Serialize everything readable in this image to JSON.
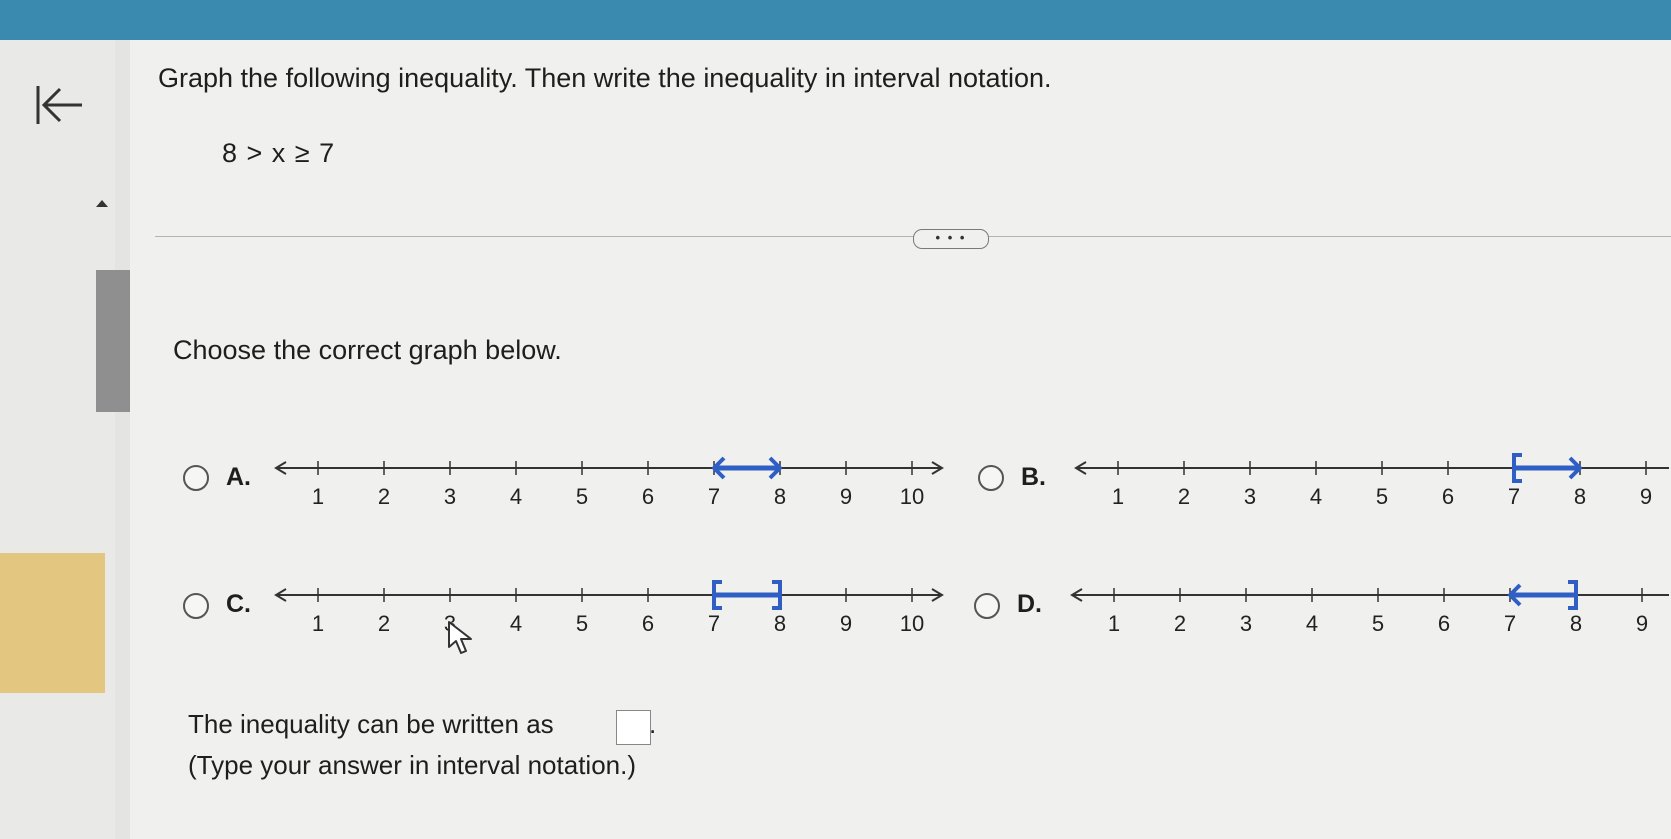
{
  "question": {
    "title": "Graph the following inequality. Then write the inequality in interval notation.",
    "inequality": "8 > x ≥ 7"
  },
  "more_button": "• • •",
  "prompt": "Choose the correct graph below.",
  "options": [
    {
      "letter": "A.",
      "ticks": [
        "1",
        "2",
        "3",
        "4",
        "5",
        "6",
        "7",
        "8",
        "9",
        "10"
      ],
      "interval": {
        "start": 7,
        "end": 8,
        "start_style": "arrow",
        "end_style": "arrow"
      }
    },
    {
      "letter": "B.",
      "ticks": [
        "1",
        "2",
        "3",
        "4",
        "5",
        "6",
        "7",
        "8",
        "9"
      ],
      "interval": {
        "start": 7,
        "end": 8,
        "start_style": "bracket",
        "end_style": "arrow"
      }
    },
    {
      "letter": "C.",
      "ticks": [
        "1",
        "2",
        "3",
        "4",
        "5",
        "6",
        "7",
        "8",
        "9",
        "10"
      ],
      "interval": {
        "start": 7,
        "end": 8,
        "start_style": "bracket",
        "end_style": "bracket"
      }
    },
    {
      "letter": "D.",
      "ticks": [
        "1",
        "2",
        "3",
        "4",
        "5",
        "6",
        "7",
        "8",
        "9"
      ],
      "interval": {
        "start": 7,
        "end": 8,
        "start_style": "arrow",
        "end_style": "bracket"
      }
    }
  ],
  "answer": {
    "text": "The inequality can be written as",
    "value": "",
    "period": ".",
    "hint": "(Type your answer in interval notation.)"
  },
  "colors": {
    "accent": "#2f5fc4",
    "topbar": "#3a8ab0",
    "highlight": "#e3c780"
  },
  "icons": {
    "back": "back-arrow-icon",
    "cursor": "mouse-pointer-icon"
  }
}
